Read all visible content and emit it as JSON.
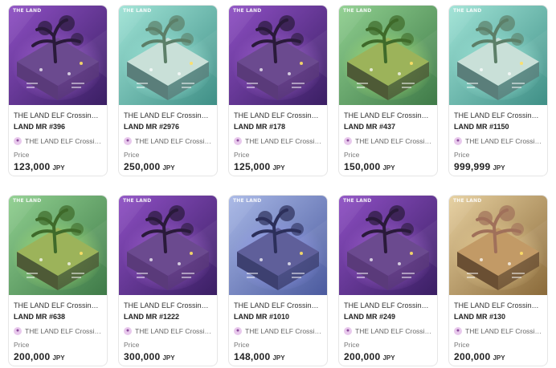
{
  "listings": [
    {
      "brand": "THE LAND",
      "title": "THE LAND ELF Crossing LA...",
      "name": "LAND MR #396",
      "collection": "THE LAND ELF Crossing...",
      "price_label": "Price",
      "price": "123,000",
      "currency": "JPY",
      "theme": "purple"
    },
    {
      "brand": "THE LAND",
      "title": "THE LAND ELF Crossing LA...",
      "name": "LAND MR #2976",
      "collection": "THE LAND ELF Crossing...",
      "price_label": "Price",
      "price": "250,000",
      "currency": "JPY",
      "theme": "teal"
    },
    {
      "brand": "THE LAND",
      "title": "THE LAND ELF Crossing LA...",
      "name": "LAND MR #178",
      "collection": "THE LAND ELF Crossing...",
      "price_label": "Price",
      "price": "125,000",
      "currency": "JPY",
      "theme": "purple"
    },
    {
      "brand": "THE LAND",
      "title": "THE LAND ELF Crossing LA...",
      "name": "LAND MR #437",
      "collection": "THE LAND ELF Crossing...",
      "price_label": "Price",
      "price": "150,000",
      "currency": "JPY",
      "theme": "green"
    },
    {
      "brand": "THE LAND",
      "title": "THE LAND ELF Crossing LA...",
      "name": "LAND MR #1150",
      "collection": "THE LAND ELF Crossing...",
      "price_label": "Price",
      "price": "999,999",
      "currency": "JPY",
      "theme": "teal"
    },
    {
      "brand": "THE LAND",
      "title": "THE LAND ELF Crossing LA...",
      "name": "LAND MR #638",
      "collection": "THE LAND ELF Crossing...",
      "price_label": "Price",
      "price": "200,000",
      "currency": "JPY",
      "theme": "green"
    },
    {
      "brand": "THE LAND",
      "title": "THE LAND ELF Crossing LA...",
      "name": "LAND MR #1222",
      "collection": "THE LAND ELF Crossing...",
      "price_label": "Price",
      "price": "300,000",
      "currency": "JPY",
      "theme": "purple"
    },
    {
      "brand": "THE LAND",
      "title": "THE LAND ELF Crossing LA...",
      "name": "LAND MR #1010",
      "collection": "THE LAND ELF Crossing...",
      "price_label": "Price",
      "price": "148,000",
      "currency": "JPY",
      "theme": "blue"
    },
    {
      "brand": "THE LAND",
      "title": "THE LAND ELF Crossing LA...",
      "name": "LAND MR #249",
      "collection": "THE LAND ELF Crossing...",
      "price_label": "Price",
      "price": "200,000",
      "currency": "JPY",
      "theme": "purple"
    },
    {
      "brand": "THE LAND",
      "title": "THE LAND ELF Crossing LA...",
      "name": "LAND MR #130",
      "collection": "THE LAND ELF Crossing...",
      "price_label": "Price",
      "price": "200,000",
      "currency": "JPY",
      "theme": "gold"
    }
  ],
  "collection_icon": "elf-avatar-icon",
  "themes": {
    "purple": {
      "bg1": "#3a1f63",
      "bg2": "#8e4fc4",
      "glow": "#c27cf0",
      "ground": "#5a3a7a",
      "top": "#6b4a8f",
      "tree": "#2a1a3a"
    },
    "teal": {
      "bg1": "#3f8f86",
      "bg2": "#9fe3d6",
      "glow": "#b8fff0",
      "ground": "#5a7e7a",
      "top": "#c9e0d8",
      "tree": "#5c7f68"
    },
    "green": {
      "bg1": "#3f7a48",
      "bg2": "#8fcf8f",
      "glow": "#c8ff7a",
      "ground": "#4e5a36",
      "top": "#9cb35a",
      "tree": "#3f6a2a"
    },
    "blue": {
      "bg1": "#4b5a9e",
      "bg2": "#a7b7e6",
      "glow": "#9fa0ff",
      "ground": "#3d4070",
      "top": "#5f5f9a",
      "tree": "#2c2f5a"
    },
    "gold": {
      "bg1": "#8a6a3a",
      "bg2": "#e6cf9e",
      "glow": "#ffe6a8",
      "ground": "#6a4f33",
      "top": "#c29a66",
      "tree": "#a0705a"
    }
  }
}
